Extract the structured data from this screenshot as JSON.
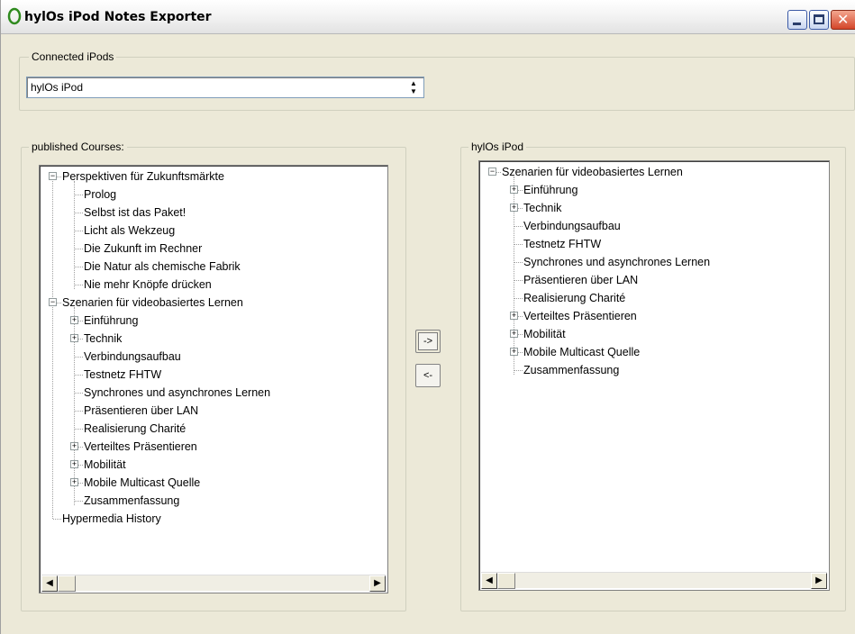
{
  "window": {
    "title": "hylOs iPod Notes Exporter"
  },
  "connected": {
    "legend": "Connected iPods",
    "selected_device": "hylOs iPod"
  },
  "published": {
    "legend": "published Courses:",
    "nodes": [
      {
        "label": "Perspektiven für Zukunftsmärkte",
        "level": 0,
        "expander": "−"
      },
      {
        "label": "Prolog",
        "level": 1,
        "expander": ""
      },
      {
        "label": "Selbst ist das Paket!",
        "level": 1,
        "expander": ""
      },
      {
        "label": "Licht als Wekzeug",
        "level": 1,
        "expander": ""
      },
      {
        "label": "Die Zukunft im Rechner",
        "level": 1,
        "expander": ""
      },
      {
        "label": "Die Natur als chemische Fabrik",
        "level": 1,
        "expander": ""
      },
      {
        "label": "Nie mehr Knöpfe drücken",
        "level": 1,
        "expander": ""
      },
      {
        "label": "Szenarien für videobasiertes Lernen",
        "level": 0,
        "expander": "−"
      },
      {
        "label": "Einführung",
        "level": 1,
        "expander": "+"
      },
      {
        "label": "Technik",
        "level": 1,
        "expander": "+"
      },
      {
        "label": "Verbindungsaufbau",
        "level": 1,
        "expander": ""
      },
      {
        "label": "Testnetz FHTW",
        "level": 1,
        "expander": ""
      },
      {
        "label": "Synchrones und asynchrones Lernen",
        "level": 1,
        "expander": ""
      },
      {
        "label": "Präsentieren über LAN",
        "level": 1,
        "expander": ""
      },
      {
        "label": "Realisierung Charité",
        "level": 1,
        "expander": ""
      },
      {
        "label": "Verteiltes Präsentieren",
        "level": 1,
        "expander": "+"
      },
      {
        "label": "Mobilität",
        "level": 1,
        "expander": "+"
      },
      {
        "label": "Mobile Multicast Quelle",
        "level": 1,
        "expander": "+"
      },
      {
        "label": "Zusammenfassung",
        "level": 1,
        "expander": ""
      },
      {
        "label": "Hypermedia History",
        "level": 0,
        "expander": ""
      }
    ]
  },
  "ipod": {
    "legend": "hylOs iPod",
    "nodes": [
      {
        "label": "Szenarien für videobasiertes Lernen",
        "level": 0,
        "expander": "−"
      },
      {
        "label": "Einführung",
        "level": 1,
        "expander": "+"
      },
      {
        "label": "Technik",
        "level": 1,
        "expander": "+"
      },
      {
        "label": "Verbindungsaufbau",
        "level": 1,
        "expander": ""
      },
      {
        "label": "Testnetz FHTW",
        "level": 1,
        "expander": ""
      },
      {
        "label": "Synchrones und asynchrones Lernen",
        "level": 1,
        "expander": ""
      },
      {
        "label": "Präsentieren über LAN",
        "level": 1,
        "expander": ""
      },
      {
        "label": "Realisierung Charité",
        "level": 1,
        "expander": ""
      },
      {
        "label": "Verteiltes Präsentieren",
        "level": 1,
        "expander": "+"
      },
      {
        "label": "Mobilität",
        "level": 1,
        "expander": "+"
      },
      {
        "label": "Mobile Multicast Quelle",
        "level": 1,
        "expander": "+"
      },
      {
        "label": "Zusammenfassung",
        "level": 1,
        "expander": ""
      }
    ]
  },
  "actions": {
    "add_label": "->",
    "remove_label": "<-"
  },
  "icons": {
    "app": "hylos-logo-icon",
    "minimize": "minimize-icon",
    "maximize": "maximize-icon",
    "close": "close-icon"
  },
  "colors": {
    "tree_bg": "#ffffff",
    "dialog_bg": "#ece9d8"
  }
}
